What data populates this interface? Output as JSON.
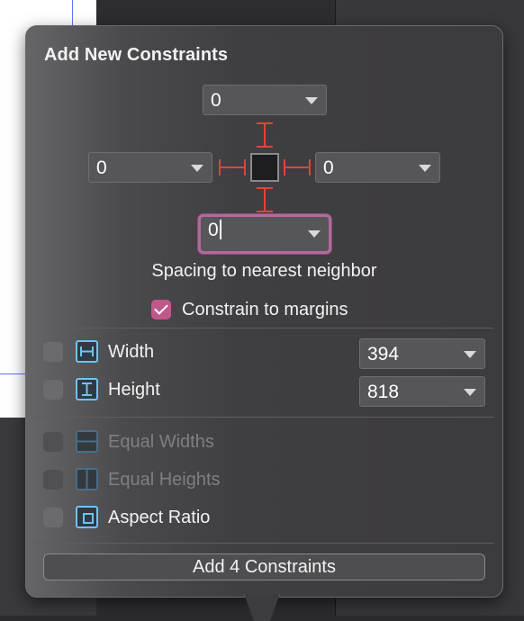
{
  "popover": {
    "title": "Add New Constraints",
    "spacing": {
      "top": "0",
      "leading": "0",
      "trailing": "0",
      "bottom": "0"
    },
    "caption": "Spacing to nearest neighbor",
    "constrain_to_margins": {
      "label": "Constrain to margins",
      "checked": true
    },
    "width": {
      "label": "Width",
      "value": "394",
      "checked": false
    },
    "height": {
      "label": "Height",
      "value": "818",
      "checked": false
    },
    "equal_widths": {
      "label": "Equal Widths",
      "enabled": false
    },
    "equal_heights": {
      "label": "Equal Heights",
      "enabled": false
    },
    "aspect_ratio": {
      "label": "Aspect Ratio",
      "checked": false
    },
    "add_button": "Add 4 Constraints"
  },
  "colors": {
    "accent": "#c1588b",
    "strut": "#e5423a",
    "icon": "#6fc3ef"
  },
  "icons": {
    "width": "width-icon",
    "height": "height-icon",
    "equal_widths": "equal-widths-icon",
    "equal_heights": "equal-heights-icon",
    "aspect_ratio": "aspect-ratio-icon"
  }
}
